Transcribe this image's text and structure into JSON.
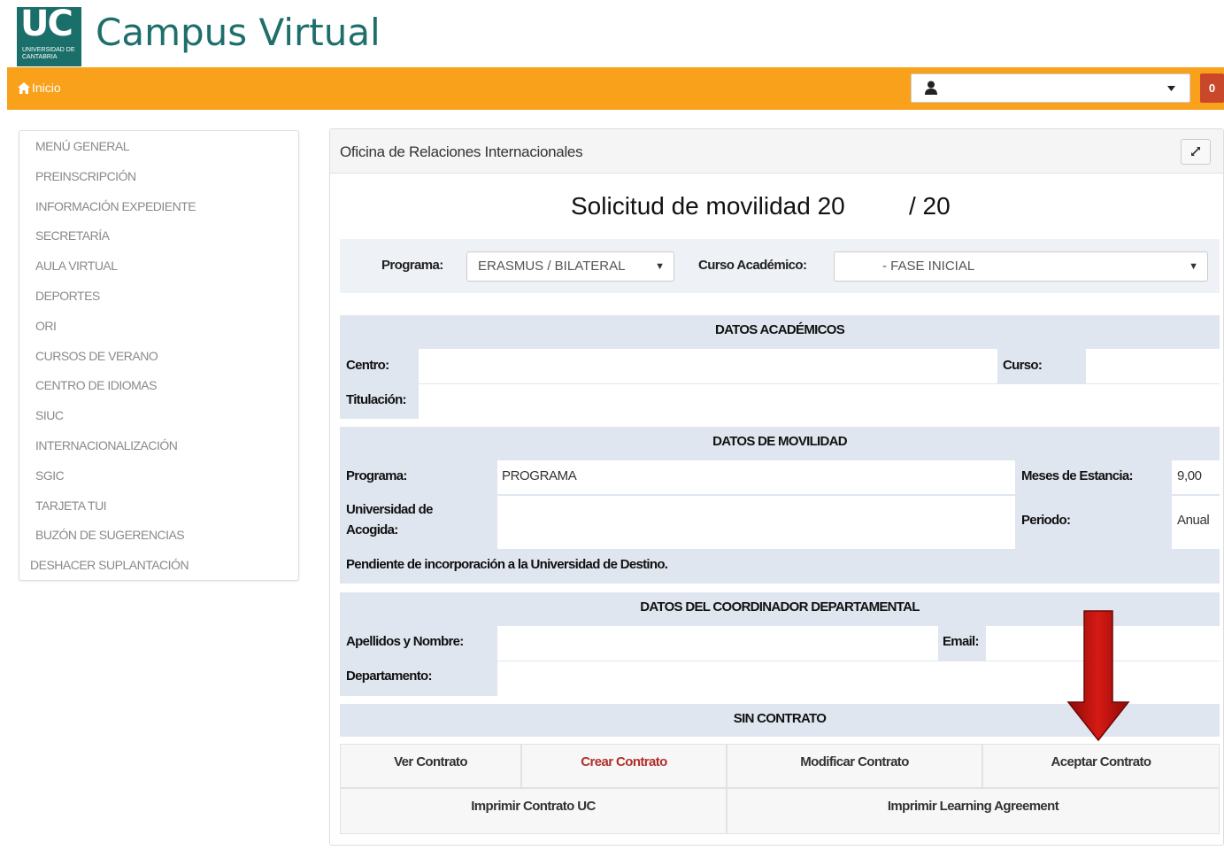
{
  "header": {
    "logo_text": "UC",
    "logo_subtext": "UNIVERSIDAD DE CANTABRIA",
    "site_title": "Campus Virtual",
    "home_label": "Inicio",
    "notification_count": "0",
    "user_select_value": ""
  },
  "sidebar": {
    "items": [
      "MENÚ GENERAL",
      "PREINSCRIPCIÓN",
      "INFORMACIÓN EXPEDIENTE",
      "SECRETARÍA",
      "AULA VIRTUAL",
      "DEPORTES",
      "ORI",
      "CURSOS DE VERANO",
      "CENTRO DE IDIOMAS",
      "SIUC",
      "INTERNACIONALIZACIÓN",
      "SGIC",
      "TARJETA TUI",
      "BUZÓN DE SUGERENCIAS",
      "DESHACER SUPLANTACIÓN"
    ]
  },
  "panel": {
    "title": "Oficina de Relaciones Internacionales",
    "heading_part1": "Solicitud de movilidad 20",
    "heading_part2": "/ 20"
  },
  "filters": {
    "programa_label": "Programa:",
    "programa_value": "ERASMUS / BILATERAL",
    "curso_label": "Curso Académico:",
    "curso_value": "- FASE INICIAL"
  },
  "academicos": {
    "title": "DATOS ACADÉMICOS",
    "centro_label": "Centro:",
    "curso_label": "Curso:",
    "titulacion_label": "Titulación:"
  },
  "movilidad": {
    "title": "DATOS DE MOVILIDAD",
    "programa_label": "Programa:",
    "programa_value": "PROGRAMA",
    "meses_label": "Meses de Estancia:",
    "meses_value": "9,00",
    "universidad_label_1": "Universidad de",
    "universidad_label_2": "Acogida:",
    "periodo_label": "Periodo:",
    "periodo_value": "Anual",
    "status_note": "Pendiente de incorporación a la Universidad de Destino."
  },
  "coordinador": {
    "title": "DATOS DEL COORDINADOR DEPARTAMENTAL",
    "nombre_label": "Apellidos y Nombre:",
    "email_label": "Email:",
    "departamento_label": "Departamento:"
  },
  "contrato": {
    "title": "SIN CONTRATO",
    "ver": "Ver Contrato",
    "crear": "Crear Contrato",
    "modificar": "Modificar Contrato",
    "aceptar": "Aceptar Contrato",
    "imprimir_contrato": "Imprimir Contrato UC",
    "imprimir_learning": "Imprimir Learning Agreement"
  },
  "colors": {
    "brand_teal": "#1e6f6c",
    "topbar_orange": "#f9a11b",
    "section_bg": "#dfe6ef",
    "arrow_red": "#b3100e",
    "crear_red": "#b0302a"
  },
  "icons": [
    "home-icon",
    "user-icon",
    "chevron-down-icon",
    "expand-icon",
    "down-arrow-icon"
  ]
}
